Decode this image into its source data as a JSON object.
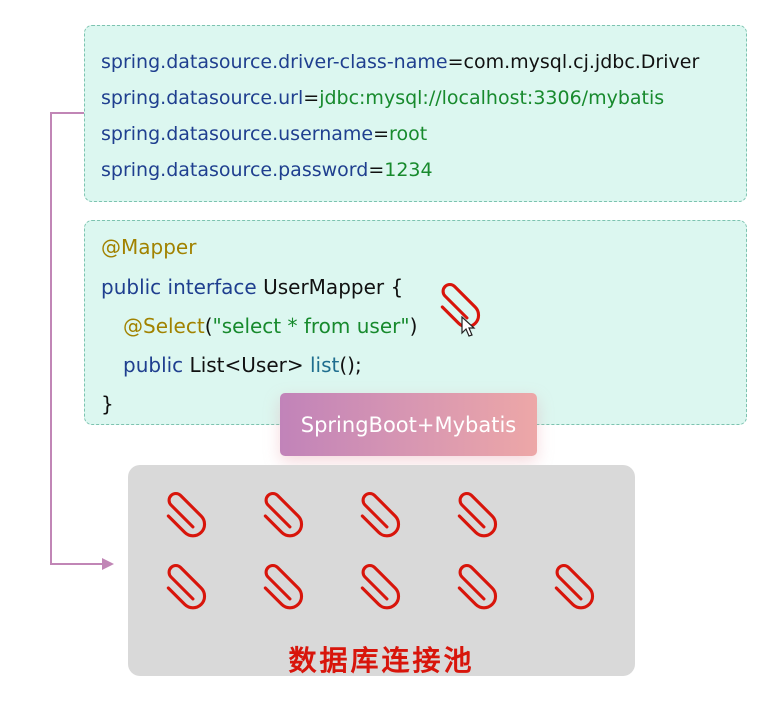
{
  "config": {
    "lines": [
      {
        "key": "spring.datasource.driver-class-name",
        "eq": "=",
        "value": "com.mysql.cj.jdbc.Driver"
      },
      {
        "key": "spring.datasource.url",
        "eq": "=",
        "value": "jdbc:mysql://localhost:3306/mybatis"
      },
      {
        "key": "spring.datasource.username",
        "eq": "=",
        "value": "root"
      },
      {
        "key": "spring.datasource.password",
        "eq": "=",
        "value": "1234"
      }
    ]
  },
  "code": {
    "line1": "@Mapper",
    "line2": {
      "kw": "public interface",
      "rest": " UserMapper {"
    },
    "line3": {
      "ann": "@Select",
      "open": "(",
      "str": "\"select  * from user\"",
      "close": ")"
    },
    "line4": {
      "kw": "public",
      "mid": " List<User> ",
      "method": "list",
      "end": "();"
    },
    "line5": "}"
  },
  "banner": {
    "label": "SpringBoot+Mybatis"
  },
  "pool": {
    "title": "数据库连接池"
  },
  "colors": {
    "box_bg": "#dcf7f0",
    "key": "#1f3f8f",
    "value_green": "#178a2d",
    "annotation": "#a18200",
    "arrow": "#c186b6",
    "clip": "#d8150b",
    "pool_bg": "#d9d9d9"
  },
  "icons": {
    "clip": "paperclip-icon",
    "cursor": "mouse-cursor-icon",
    "arrow": "connector-arrow"
  }
}
